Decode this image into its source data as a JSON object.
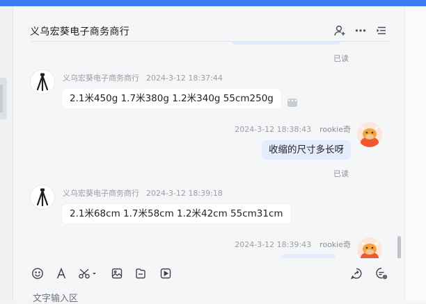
{
  "header": {
    "title": "义乌宏葵电子商务商行",
    "icons": [
      "add-user-icon",
      "more-icon",
      "menu-list-icon"
    ]
  },
  "messages": [
    {
      "id": "m0",
      "direction": "out",
      "read_label": "已读"
    },
    {
      "id": "m1",
      "direction": "in",
      "sender": "义乌宏葵电子商务商行",
      "time": "2024-3-12 18:37:44",
      "text": "2.1米450g  1.7米380g 1.2米340g   55cm250g"
    },
    {
      "id": "m2",
      "direction": "out",
      "sender": "rookie奇",
      "time": "2024-3-12 18:38:43",
      "text": "收缩的尺寸多长呀",
      "read_label": "已读"
    },
    {
      "id": "m3",
      "direction": "in",
      "sender": "义乌宏葵电子商务商行",
      "time": "2024-3-12 18:39:18",
      "text": "2.1米68cm  1.7米58cm  1.2米42cm  55cm31cm"
    },
    {
      "id": "m4",
      "direction": "out",
      "sender": "rookie奇",
      "time": "2024-3-12 18:39:43"
    }
  ],
  "toolbar": {
    "icons": [
      "emoji-icon",
      "font-icon",
      "scissors-icon",
      "image-icon",
      "file-icon",
      "video-icon",
      "quick-reply-icon",
      "chat-settings-icon"
    ]
  },
  "input": {
    "placeholder": "文字输入区"
  },
  "colors": {
    "accent": "#3f7cf4",
    "bubble_out": "#e4ecfd",
    "bubble_in": "#ffffff"
  }
}
